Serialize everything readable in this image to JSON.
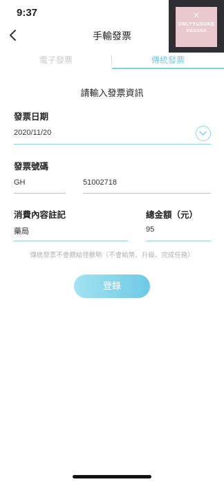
{
  "status_bar": {
    "time": "9:37"
  },
  "watermark": {
    "symbol": "×",
    "line1": "ONLYYUSUKE",
    "line2": "佑佑佑佑佑佑"
  },
  "nav": {
    "title": "手輸發票",
    "back_icon": "chevron-left-icon"
  },
  "tabs": [
    {
      "label": "電子發票",
      "active": false
    },
    {
      "label": "傳統發票",
      "active": true
    }
  ],
  "form": {
    "heading": "請輸入發票資訊",
    "date": {
      "label": "發票日期",
      "value": "2020/11/20",
      "icon": "chevron-down-circle-icon"
    },
    "invoice_number": {
      "label": "發票號碼",
      "prefix": "GH",
      "number": "51002718"
    },
    "note": {
      "label": "消費內容註記",
      "value": "藥局"
    },
    "total": {
      "label": "總金額（元）",
      "value": "95"
    },
    "notice": "傳統發票不會餵給怪獸喲（不會給幣、升級、完成任務）",
    "submit_label": "登錄"
  },
  "colors": {
    "accent": "#6fcbe6",
    "line": "#8fd3ea",
    "muted": "#c9c9c9"
  }
}
